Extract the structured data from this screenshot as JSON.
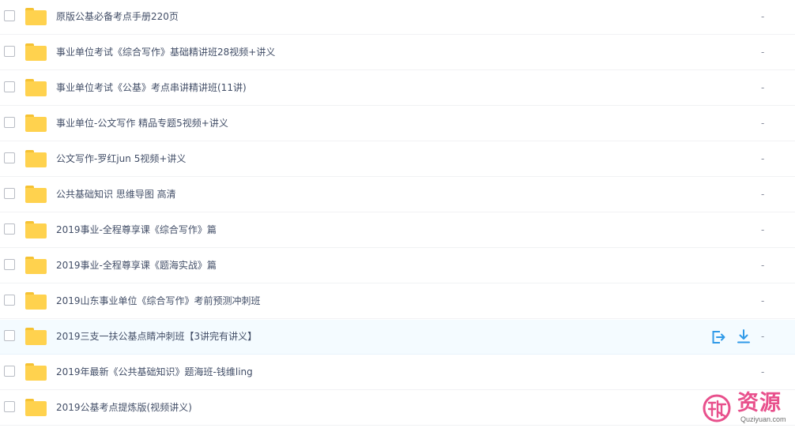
{
  "files": [
    {
      "name": "原版公基必备考点手册220页",
      "size": "-"
    },
    {
      "name": "事业单位考试《综合写作》基础精讲班28视频+讲义",
      "size": "-"
    },
    {
      "name": "事业单位考试《公基》考点串讲精讲班(11讲)",
      "size": "-"
    },
    {
      "name": "事业单位-公文写作 精品专题5视频+讲义",
      "size": "-"
    },
    {
      "name": "公文写作-罗红jun 5视频+讲义",
      "size": "-"
    },
    {
      "name": "公共基础知识 思维导图 高清",
      "size": "-"
    },
    {
      "name": "2019事业-全程尊享课《综合写作》篇",
      "size": "-"
    },
    {
      "name": "2019事业-全程尊享课《题海实战》篇",
      "size": "-"
    },
    {
      "name": "2019山东事业单位《综合写作》考前预测冲刺班",
      "size": "-"
    },
    {
      "name": "2019三支一扶公基点睛冲刺班【3讲完有讲义】",
      "size": "-",
      "hovered": true
    },
    {
      "name": "2019年最新《公共基础知识》题海班-钱维ling",
      "size": "-"
    },
    {
      "name": "2019公基考点提炼版(视频讲义)",
      "size": "-"
    }
  ],
  "hover_actions": [
    "share-icon",
    "download-icon"
  ],
  "colors": {
    "folder": "#ffd24e",
    "accent": "#2f9ae8",
    "hover_row": "#f4fbff",
    "watermark": "#e8508c"
  },
  "watermark": {
    "text": "资源",
    "domain": "Quziyuan.com"
  }
}
